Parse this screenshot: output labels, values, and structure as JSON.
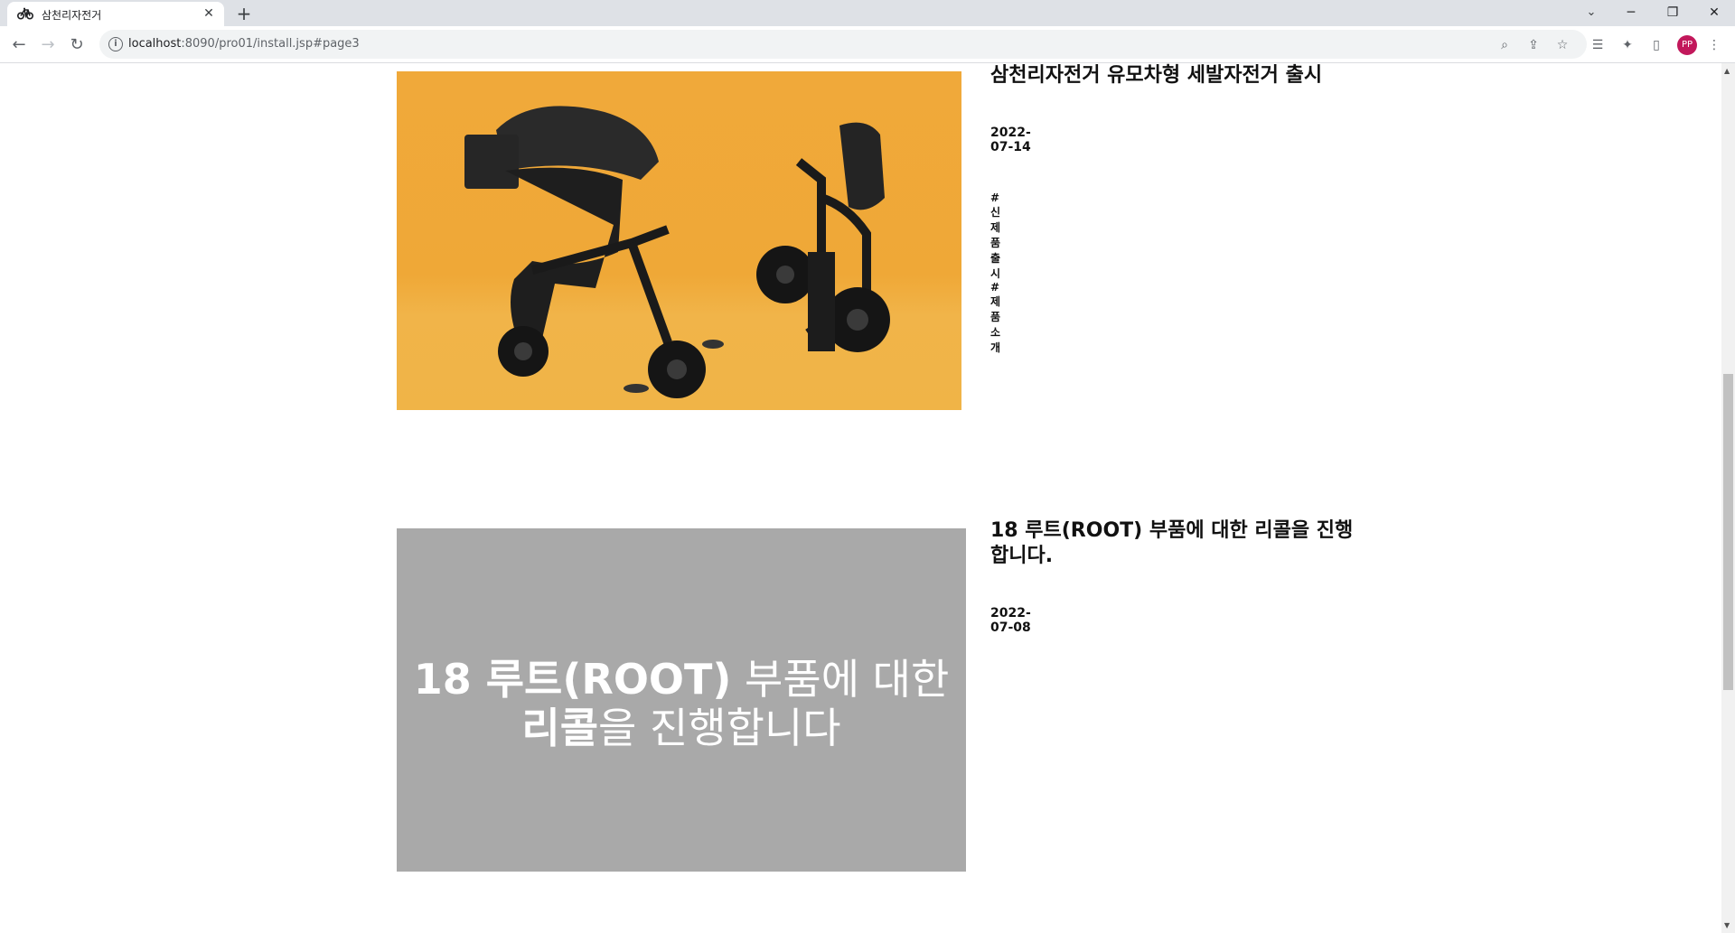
{
  "browser": {
    "tab_title": "삼천리자전거",
    "url_host": "localhost",
    "url_rest": ":8090/pro01/install.jsp#page3",
    "profile_initials": "PP"
  },
  "posts": [
    {
      "title": "삼천리자전거 유모차형 세발자전거 출시",
      "date": "2022-07-14",
      "tags": "#신제품 출시 #제품소개",
      "image_alt": "black foldable stroller tricycles on orange background"
    },
    {
      "title": "18 루트(ROOT) 부품에 대한 리콜을 진행합니다.",
      "date": "2022-07-08",
      "image_line1_bold": "18 루트(ROOT)",
      "image_line1_rest": " 부품에 대한",
      "image_line2_bold": "리콜",
      "image_line2_rest": "을 진행합니다"
    }
  ],
  "colors": {
    "tab_bar": "#dee1e6",
    "image1_bg": "#efa837",
    "image2_bg": "#a9a9a9",
    "avatar": "#c2185b"
  }
}
